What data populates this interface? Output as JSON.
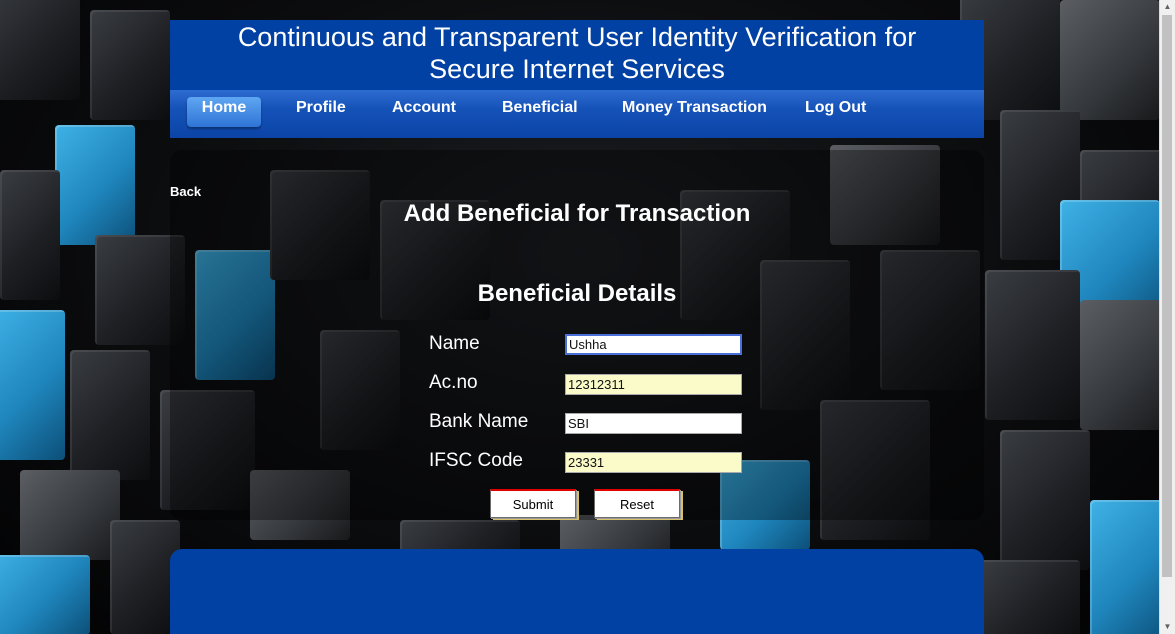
{
  "header": {
    "title_line1": "Continuous and Transparent User Identity Verification for",
    "title_line2": "Secure Internet Services"
  },
  "nav": {
    "items": [
      "Home",
      "Profile",
      "Account",
      "Beneficial",
      "Money Transaction",
      "Log Out"
    ],
    "active": "Home"
  },
  "back_label": "Back",
  "page_title": "Add Beneficial for Transaction",
  "form": {
    "section_title": "Beneficial Details",
    "fields": [
      {
        "label": "Name",
        "value": "Ushha"
      },
      {
        "label": "Ac.no",
        "value": "12312311"
      },
      {
        "label": "Bank Name",
        "value": "SBI"
      },
      {
        "label": "IFSC Code",
        "value": "23331"
      }
    ],
    "submit_label": "Submit",
    "reset_label": "Reset"
  },
  "colors": {
    "header_blue": "#0241a4",
    "nav_blue": "#1552b8",
    "field_yellow": "#fafbc8",
    "accent_cube_blue": "#1f86bd"
  }
}
